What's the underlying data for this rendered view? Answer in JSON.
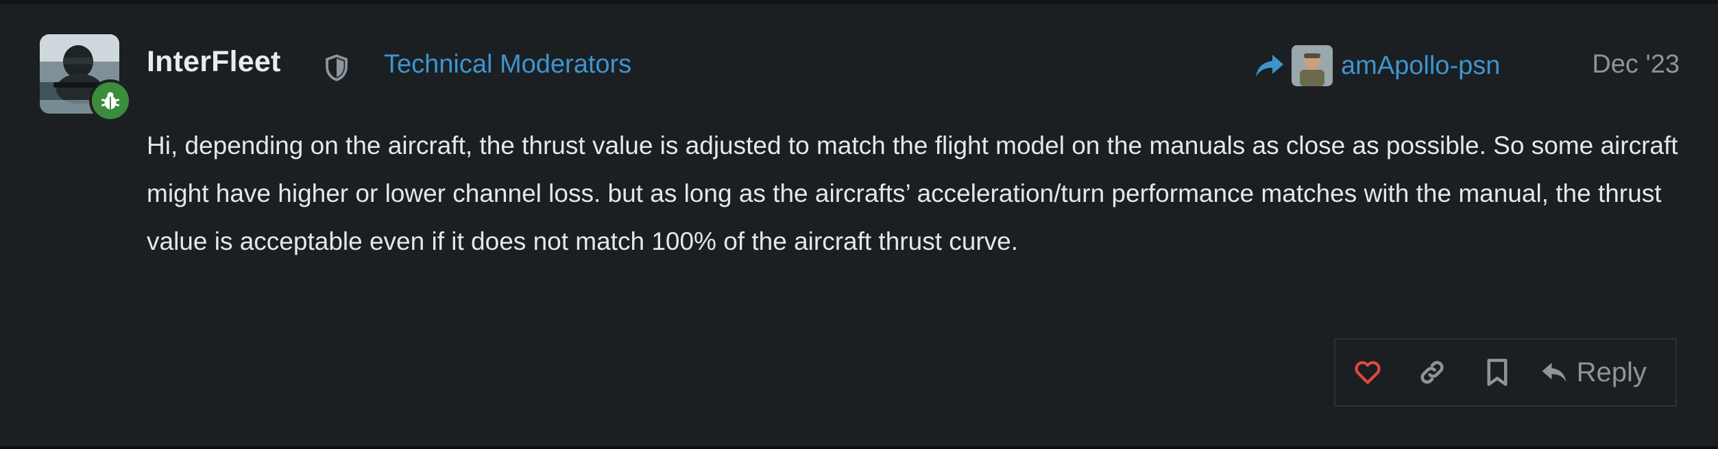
{
  "post": {
    "username": "InterFleet",
    "group": "Technical Moderators",
    "reply_to": {
      "username": "amApollo-psn"
    },
    "date": "Dec '23",
    "body": "Hi, depending on the aircraft, the thrust value is adjusted to match the flight model on the manuals as close as possible. So some aircraft might have higher or lower channel loss. but as long as the aircrafts’ acceleration/turn performance matches with the manual, the thrust value is acceptable even if it does not match 100% of the aircraft thrust curve."
  },
  "actions": {
    "reply_label": "Reply"
  },
  "icons": {
    "badge": "bug-icon",
    "role": "shield-icon",
    "reply_to": "share-arrow-icon",
    "like": "heart-icon",
    "link": "link-icon",
    "bookmark": "bookmark-icon",
    "reply": "reply-icon"
  },
  "colors": {
    "background": "#1b1f22",
    "username": "#e8ecef",
    "accent": "#3d95d0",
    "muted": "#8c959b",
    "like": "#e0493e",
    "badge": "#3b8c3c"
  }
}
